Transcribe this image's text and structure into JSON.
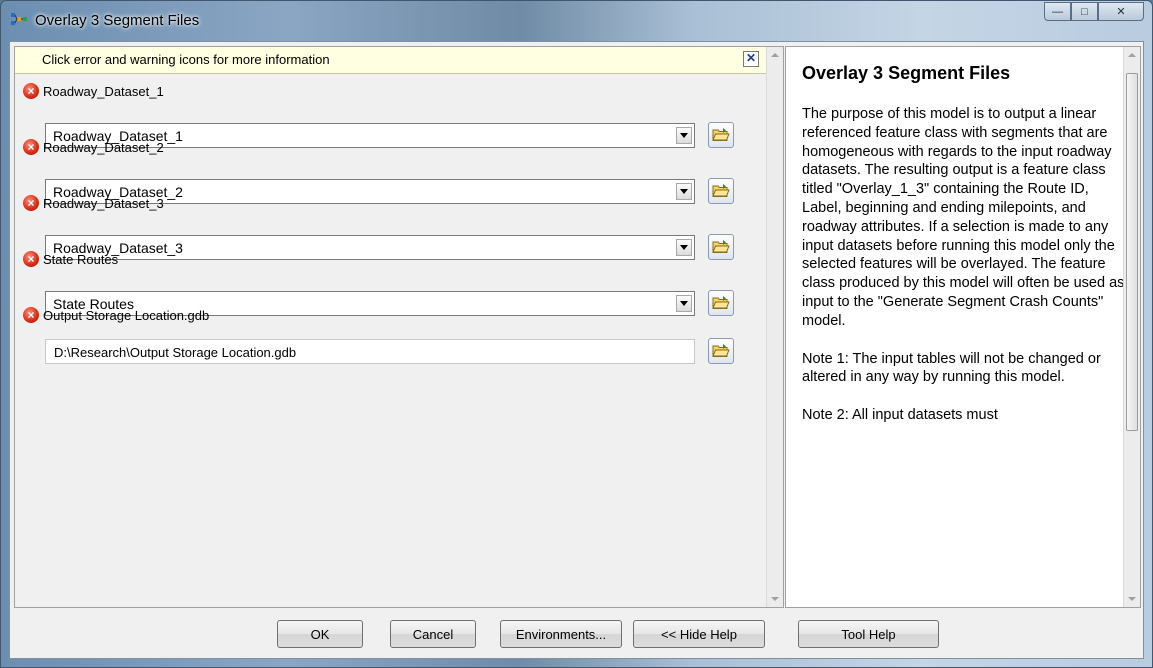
{
  "window": {
    "title": "Overlay 3 Segment Files",
    "caption_buttons": {
      "minimize": "—",
      "maximize": "□",
      "close": "✕"
    }
  },
  "info_bar": {
    "message": "Click error and warning icons for more information",
    "close_glyph": "✕"
  },
  "parameters": [
    {
      "label": "Roadway_Dataset_1",
      "value": "Roadway_Dataset_1",
      "control": "dropdown",
      "status": "error"
    },
    {
      "label": "Roadway_Dataset_2",
      "value": "Roadway_Dataset_2",
      "control": "dropdown",
      "status": "error"
    },
    {
      "label": "Roadway_Dataset_3",
      "value": "Roadway_Dataset_3",
      "control": "dropdown",
      "status": "error"
    },
    {
      "label": "State Routes",
      "value": "State Routes",
      "control": "dropdown",
      "status": "error"
    },
    {
      "label": "Output Storage Location.gdb",
      "value": "D:\\Research\\Output Storage Location.gdb",
      "control": "text",
      "status": "error"
    }
  ],
  "help": {
    "title": "Overlay 3 Segment Files",
    "paragraphs": [
      "The purpose of this model is to output a linear referenced feature class with segments that are homogeneous with regards to the input roadway datasets. The resulting output is a feature class titled \"Overlay_1_3\" containing the Route ID, Label, beginning and ending milepoints, and roadway attributes. If a selection is made to any input datasets before running this model only the selected features will be overlayed. The feature class produced by this model will often be used as input to the \"Generate Segment Crash Counts\" model.",
      "Note 1: The input tables will not be changed or altered in any way by running this model.",
      "Note 2: All input datasets must"
    ]
  },
  "buttons": {
    "ok": "OK",
    "cancel": "Cancel",
    "environments": "Environments...",
    "hide_help": "<< Hide Help",
    "tool_help": "Tool Help"
  },
  "colors": {
    "info_bar_bg": "#ffffe1",
    "error_red": "#d12b14",
    "dialog_bg": "#f0f0f0"
  },
  "icons": {
    "app": "model-icon",
    "error": "error-icon",
    "browse": "open-folder-icon"
  }
}
